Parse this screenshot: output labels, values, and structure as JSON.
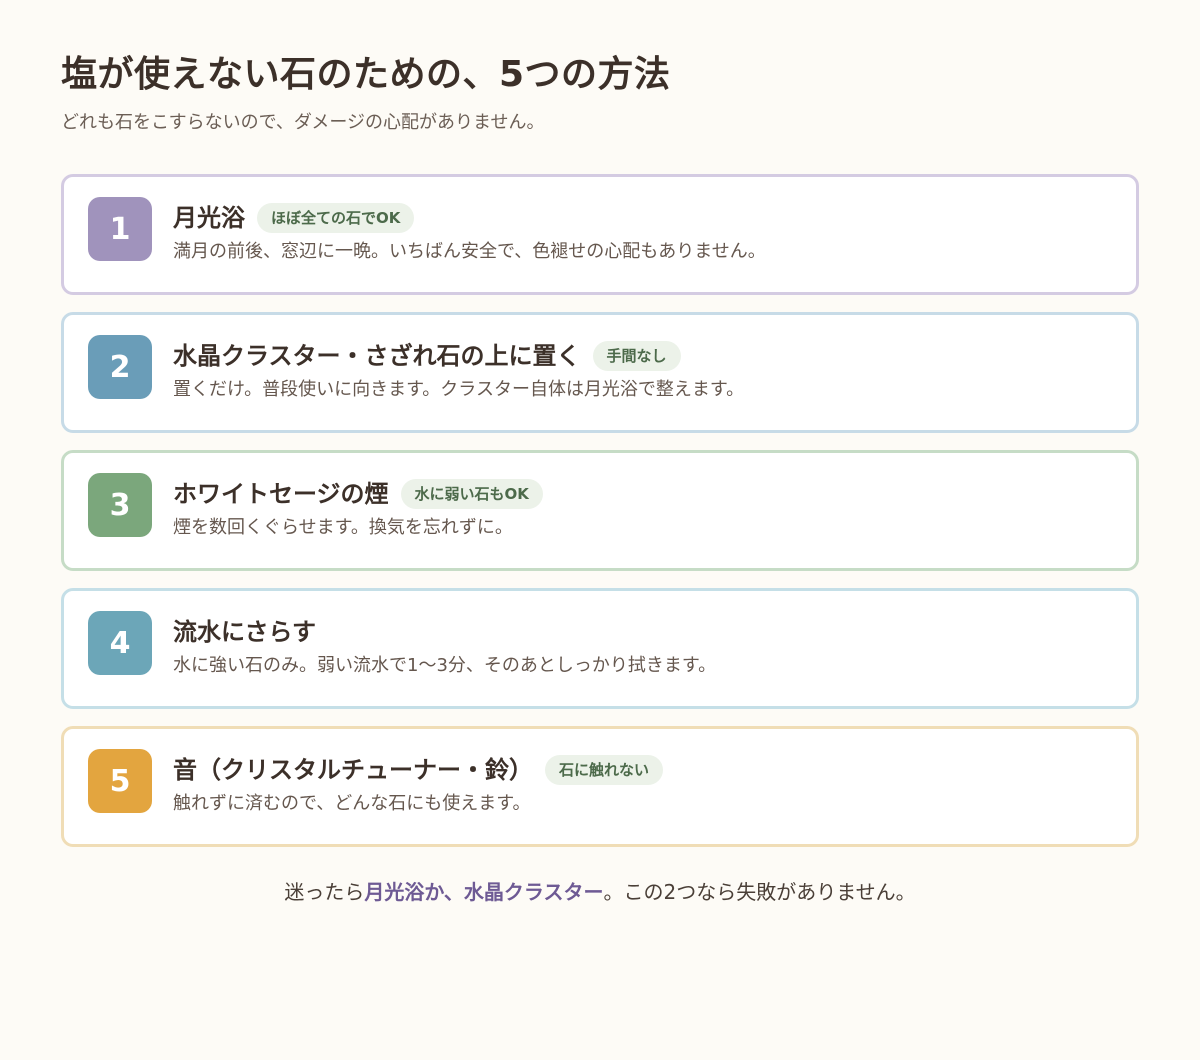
{
  "header": {
    "title": "塩が使えない石のための、5つの方法",
    "subtitle": "どれも石をこすらないので、ダメージの心配がありません。"
  },
  "methods": [
    {
      "number": "1",
      "title": "月光浴",
      "tag": "ほぼ全ての石でOK",
      "description": "満月の前後、窓辺に一晩。いちばん安全で、色褪せの心配もありません。",
      "accent_color": "#a093bc",
      "border_color": "#d4cbe2"
    },
    {
      "number": "2",
      "title": "水晶クラスター・さざれ石の上に置く",
      "tag": "手間なし",
      "description": "置くだけ。普段使いに向きます。クラスター自体は月光浴で整えます。",
      "accent_color": "#6a9db8",
      "border_color": "#c7dbe7"
    },
    {
      "number": "3",
      "title": "ホワイトセージの煙",
      "tag": "水に弱い石もOK",
      "description": "煙を数回くぐらせます。換気を忘れずに。",
      "accent_color": "#7ba77c",
      "border_color": "#c6dcc6"
    },
    {
      "number": "4",
      "title": "流水にさらす",
      "tag": "",
      "description": "水に強い石のみ。弱い流水で1〜3分、そのあとしっかり拭きます。",
      "accent_color": "#6ca6b8",
      "border_color": "#c5dfe7"
    },
    {
      "number": "5",
      "title": "音（クリスタルチューナー・鈴）",
      "tag": "石に触れない",
      "description": "触れずに済むので、どんな石にも使えます。",
      "accent_color": "#e3a53f",
      "border_color": "#f0ddb6"
    }
  ],
  "footer": {
    "prefix": "迷ったら",
    "highlight": "月光浴か、水晶クラスター",
    "suffix": "。この2つなら失敗がありません。"
  }
}
